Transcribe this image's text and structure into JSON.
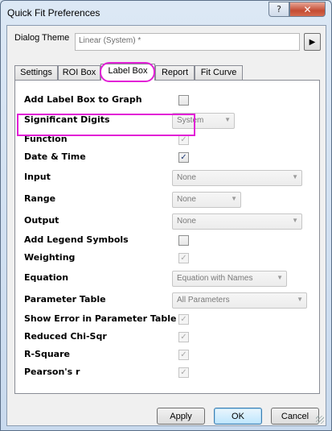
{
  "window": {
    "title": "Quick Fit Preferences",
    "help_label": "?",
    "close_label": "✕"
  },
  "theme": {
    "label": "Dialog Theme",
    "value": "Linear (System) *",
    "arrow": "▶"
  },
  "tabs": [
    {
      "label": "Settings"
    },
    {
      "label": "ROI Box"
    },
    {
      "label": "Label Box",
      "active": true
    },
    {
      "label": "Report"
    },
    {
      "label": "Fit Curve"
    }
  ],
  "rows": {
    "add_label_box": {
      "label": "Add Label Box to Graph",
      "checked": false
    },
    "significant_digits": {
      "label": "Significant Digits",
      "value": "System"
    },
    "function": {
      "label": "Function",
      "checked": true,
      "disabled": true
    },
    "date_time": {
      "label": "Date & Time",
      "checked": true
    },
    "input": {
      "label": "Input",
      "value": "None"
    },
    "range": {
      "label": "Range",
      "value": "None"
    },
    "output": {
      "label": "Output",
      "value": "None"
    },
    "legend_symbols": {
      "label": "Add Legend Symbols",
      "checked": false
    },
    "weighting": {
      "label": "Weighting",
      "checked": true,
      "disabled": true
    },
    "equation": {
      "label": "Equation",
      "value": "Equation with Names"
    },
    "parameter_table": {
      "label": "Parameter Table",
      "value": "All Parameters"
    },
    "show_error": {
      "label": "Show Error in Parameter Table",
      "checked": true,
      "disabled": true
    },
    "reduced_chi": {
      "label": "Reduced Chi-Sqr",
      "checked": true,
      "disabled": true
    },
    "r_square": {
      "label": "R-Square",
      "checked": true,
      "disabled": true
    },
    "pearson": {
      "label": "Pearson's r",
      "checked": true,
      "disabled": true
    }
  },
  "check_mark": "✓",
  "dropdown_arrow": "▼",
  "buttons": {
    "apply": "Apply",
    "ok": "OK",
    "cancel": "Cancel"
  },
  "colors": {
    "highlight": "#e21fd6",
    "title_bg": "#c9daee"
  }
}
